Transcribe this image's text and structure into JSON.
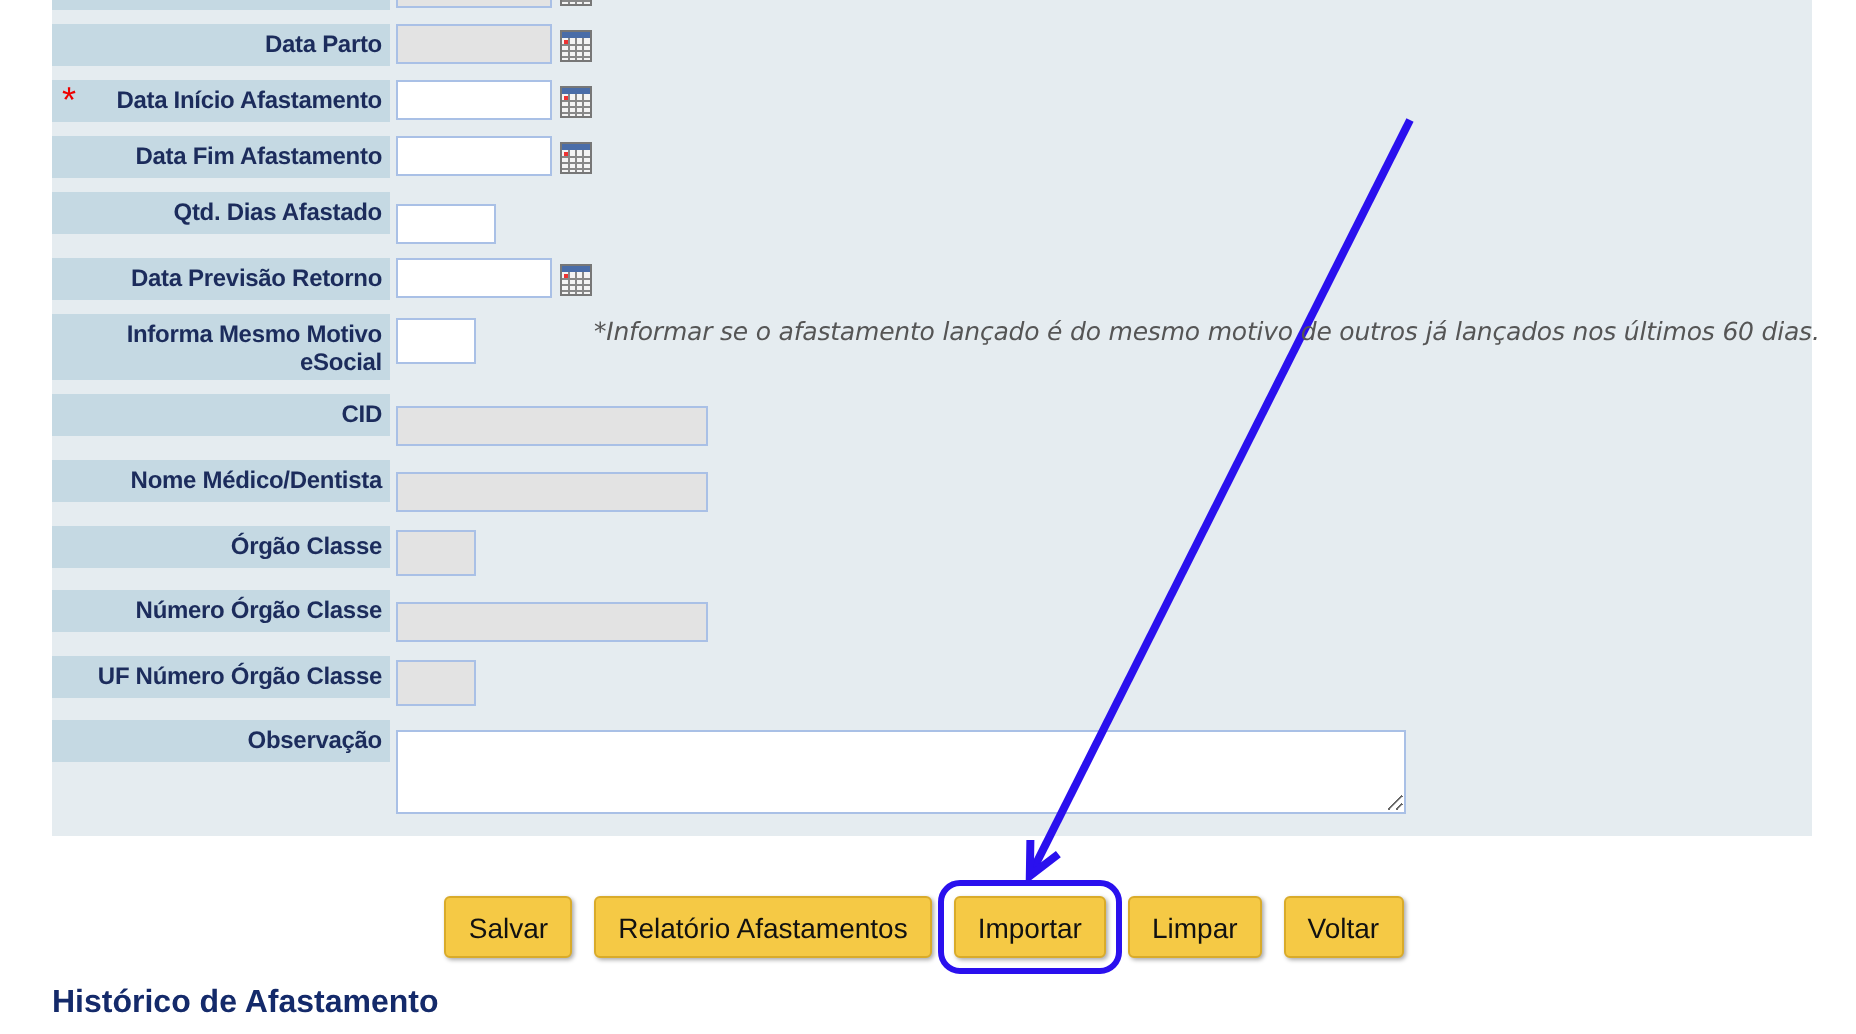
{
  "form": {
    "rows": [
      {
        "kind": "date",
        "disabled": true
      },
      {
        "label": "Data Parto",
        "kind": "date",
        "disabled": true
      },
      {
        "label": "Data Início Afastamento",
        "marker": "*",
        "kind": "date",
        "disabled": false
      },
      {
        "label": "Data Fim Afastamento",
        "kind": "date",
        "disabled": false
      },
      {
        "label": "Qtd. Dias Afastado",
        "kind": "short",
        "disabled": false
      },
      {
        "label": "Data Previsão Retorno",
        "kind": "date",
        "disabled": false
      },
      {
        "label": "Informa Mesmo Motivo eSocial",
        "kind": "small",
        "disabled": false,
        "note": "*Informar se o afastamento lançado é do mesmo motivo de outros já lançados nos últimos 60 dias."
      },
      {
        "label": "CID",
        "kind": "wide",
        "disabled": true
      },
      {
        "label": "Nome Médico/Dentista",
        "kind": "wide",
        "disabled": true
      },
      {
        "label": "Órgão Classe",
        "kind": "small",
        "disabled": true
      },
      {
        "label": "Número Órgão Classe",
        "kind": "wide",
        "disabled": true
      },
      {
        "label": "UF Número Órgão Classe",
        "kind": "small",
        "disabled": true
      },
      {
        "label": "Observação",
        "kind": "textarea",
        "disabled": false
      }
    ]
  },
  "buttons": [
    {
      "label": "Salvar",
      "highlighted": false
    },
    {
      "label": "Relatório Afastamentos",
      "highlighted": false
    },
    {
      "label": "Importar",
      "highlighted": true
    },
    {
      "label": "Limpar",
      "highlighted": false
    },
    {
      "label": "Voltar",
      "highlighted": false
    }
  ],
  "section_title": "Histórico de Afastamento"
}
